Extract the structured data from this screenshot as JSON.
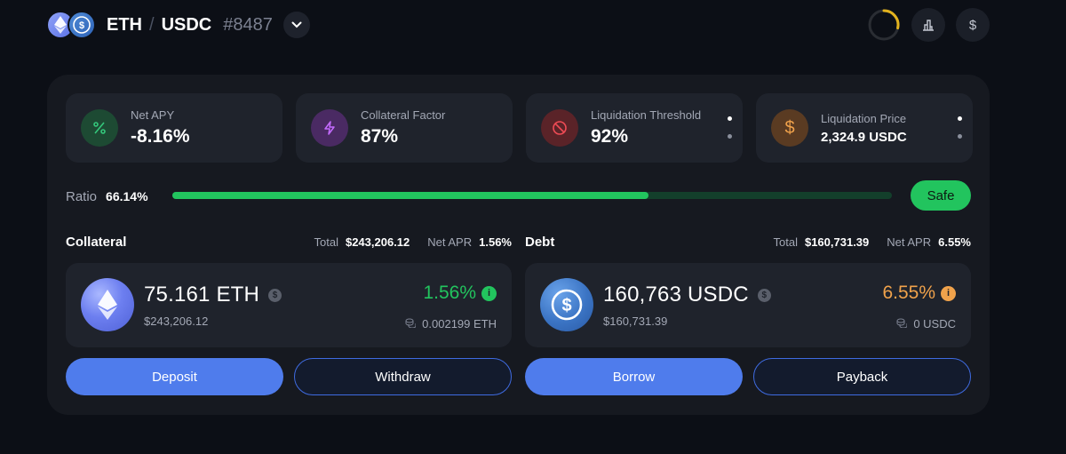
{
  "header": {
    "base": "ETH",
    "separator": "/",
    "quote": "USDC",
    "vault_id": "#8487"
  },
  "stats": [
    {
      "label": "Net APY",
      "value": "-8.16%",
      "icon": "percent-icon",
      "color": "#34c77b"
    },
    {
      "label": "Collateral Factor",
      "value": "87%",
      "icon": "lightning-icon",
      "color": "#c46bff"
    },
    {
      "label": "Liquidation Threshold",
      "value": "92%",
      "icon": "prohibited-icon",
      "color": "#ef4b55"
    },
    {
      "label": "Liquidation Price",
      "value": "2,324.9 USDC",
      "icon": "dollar-icon",
      "color": "#f0a24b"
    }
  ],
  "ratio": {
    "label": "Ratio",
    "value": "66.14%",
    "progress": 0.6614,
    "status": "Safe",
    "bar_color": "#22c45e"
  },
  "collateral": {
    "title": "Collateral",
    "total_label": "Total",
    "total": "$243,206.12",
    "apr_label": "Net APR",
    "apr": "1.56%",
    "amount": "75.161 ETH",
    "usd": "$243,206.12",
    "rate": "1.56%",
    "earned": "0.002199 ETH",
    "rate_color": "#22c45e"
  },
  "debt": {
    "title": "Debt",
    "total_label": "Total",
    "total": "$160,731.39",
    "apr_label": "Net APR",
    "apr": "6.55%",
    "amount": "160,763 USDC",
    "usd": "$160,731.39",
    "rate": "6.55%",
    "earned": "0 USDC",
    "rate_color": "#f0a24b"
  },
  "actions": {
    "deposit": "Deposit",
    "withdraw": "Withdraw",
    "borrow": "Borrow",
    "payback": "Payback"
  },
  "colors": {
    "accent": "#4f7cec",
    "background": "#0c0f16",
    "panel": "#161920",
    "card": "#1f232c"
  }
}
